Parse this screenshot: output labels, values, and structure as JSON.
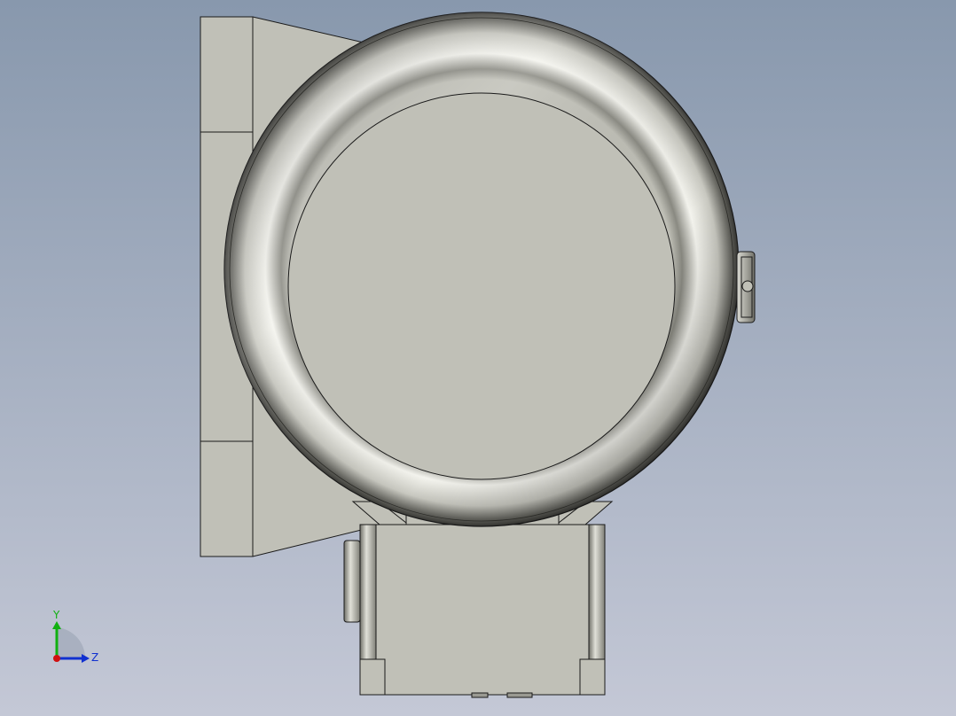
{
  "colors": {
    "bg_top": "#8898ad",
    "bg_bottom": "#c4c8d6",
    "part_face": "#c0c0b7",
    "part_edge": "#1a1a1a",
    "axis_x": "#d01010",
    "axis_y": "#10b010",
    "axis_z": "#1030d0"
  },
  "triad": {
    "y_label": "Y",
    "z_label": "Z"
  }
}
